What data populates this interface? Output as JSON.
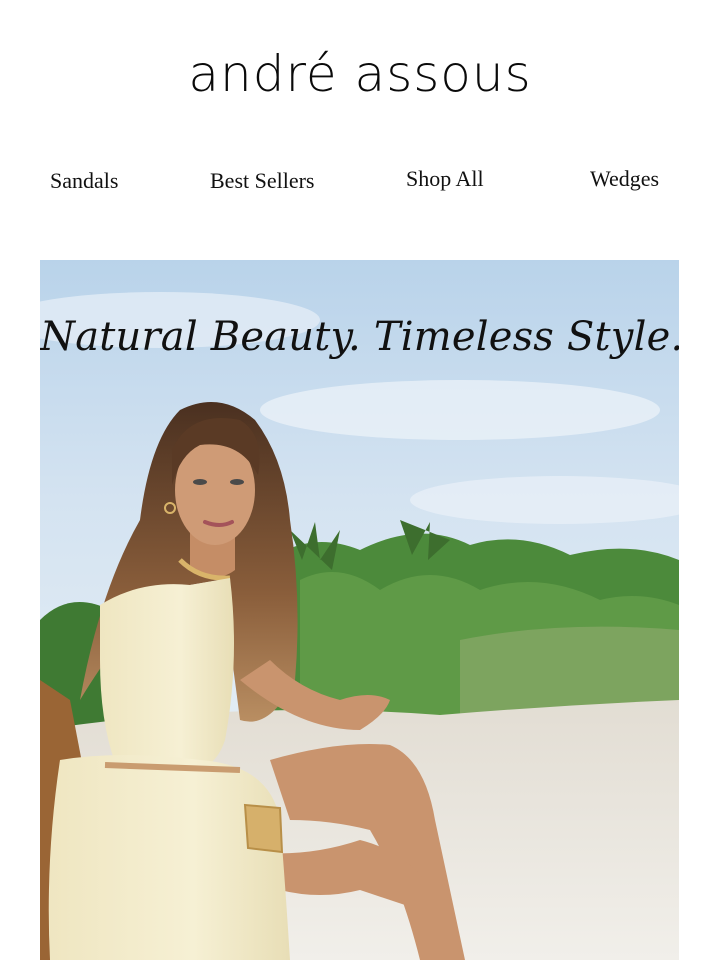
{
  "brand": {
    "logo_text": "andré assous"
  },
  "nav": {
    "items": [
      {
        "label": "Sandals"
      },
      {
        "label": "Best Sellers"
      },
      {
        "label": "Shop All"
      },
      {
        "label": "Wedges"
      }
    ]
  },
  "hero": {
    "headline": "Natural Beauty. Timeless Style.",
    "colors": {
      "sky": "#cfe0f0",
      "sand": "#ece9e3",
      "foliage": "#4f8a3c",
      "dress": "#f3eccb",
      "chair": "#a8703d"
    }
  }
}
